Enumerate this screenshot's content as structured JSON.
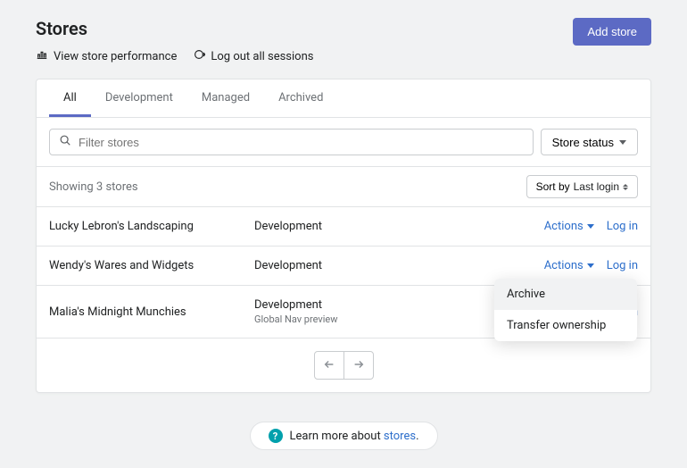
{
  "header": {
    "title": "Stores",
    "perf_link": "View store performance",
    "logout_link": "Log out all sessions",
    "add_button": "Add store"
  },
  "tabs": [
    {
      "label": "All",
      "active": true
    },
    {
      "label": "Development",
      "active": false
    },
    {
      "label": "Managed",
      "active": false
    },
    {
      "label": "Archived",
      "active": false
    }
  ],
  "filter": {
    "placeholder": "Filter stores",
    "status_label": "Store status"
  },
  "summary": {
    "count_text": "Showing 3 stores",
    "sort_label": "Sort by",
    "sort_value": "Last login"
  },
  "rows": [
    {
      "name": "Lucky Lebron's Landscaping",
      "type": "Development",
      "sub": ""
    },
    {
      "name": "Wendy's Wares and Widgets",
      "type": "Development",
      "sub": ""
    },
    {
      "name": "Malia's Midnight Munchies",
      "type": "Development",
      "sub": "Global Nav preview"
    }
  ],
  "row_actions": {
    "actions_label": "Actions",
    "login_label": "Log in"
  },
  "dropdown": [
    "Archive",
    "Transfer ownership"
  ],
  "footer": {
    "prefix": "Learn more about ",
    "link": "stores",
    "suffix": "."
  }
}
